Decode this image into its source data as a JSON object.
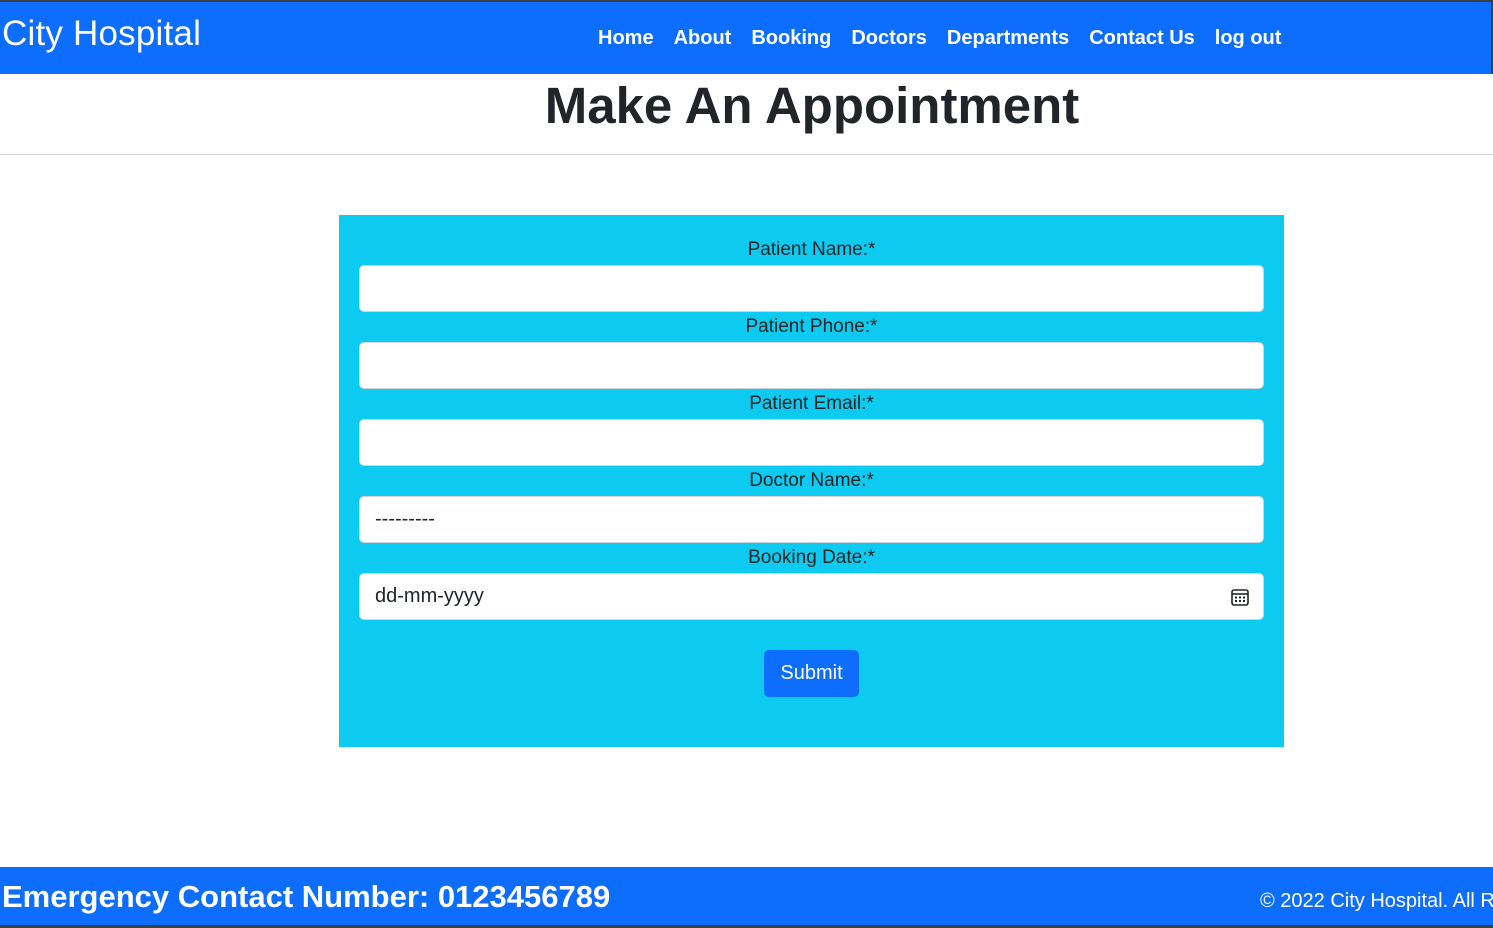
{
  "navbar": {
    "brand": "City Hospital",
    "links": [
      "Home",
      "About",
      "Booking",
      "Doctors",
      "Departments",
      "Contact Us",
      "log out"
    ]
  },
  "page_title": "Make An Appointment",
  "form": {
    "fields": [
      {
        "label": "Patient Name:*",
        "value": "",
        "placeholder": ""
      },
      {
        "label": "Patient Phone:*",
        "value": "",
        "placeholder": ""
      },
      {
        "label": "Patient Email:*",
        "value": "",
        "placeholder": ""
      },
      {
        "label": "Doctor Name:*",
        "value": "---------"
      },
      {
        "label": "Booking Date:*",
        "value": "dd-mm-yyyy",
        "icon": "calendar-icon"
      }
    ],
    "submit_label": "Submit"
  },
  "footer": {
    "emergency": "Emergency Contact Number: 0123456789",
    "copyright": "© 2022 City Hospital. All R"
  },
  "colors": {
    "primary": "#0d6efd",
    "panel": "#0dcaf0",
    "text": "#212529"
  }
}
